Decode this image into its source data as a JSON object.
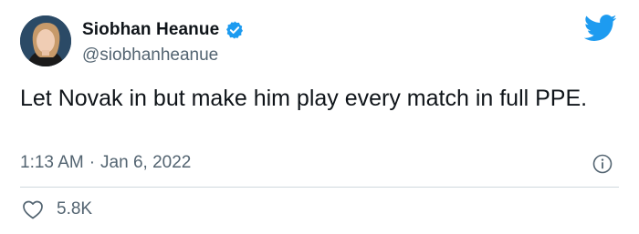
{
  "author": {
    "name": "Siobhan Heanue",
    "handle": "@siobhanheanue",
    "verified": true
  },
  "tweet": {
    "text": "Let Novak in but make him play every match in full PPE.",
    "time": "1:13 AM",
    "separator": "·",
    "date": "Jan 6, 2022"
  },
  "engagement": {
    "likes": "5.8K"
  },
  "icons": {
    "brand": "twitter-bird-icon",
    "verified": "verified-badge-icon",
    "info": "info-icon",
    "like": "heart-icon"
  },
  "colors": {
    "brand_blue": "#1d9bf0",
    "text_primary": "#0f1419",
    "text_secondary": "#536471",
    "divider": "#cfd9de"
  }
}
